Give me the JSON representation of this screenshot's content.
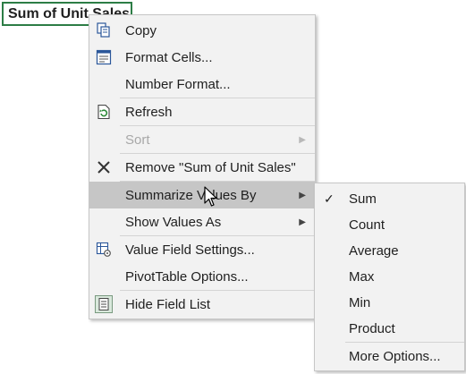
{
  "cell": {
    "text": "Sum of Unit Sales"
  },
  "context_menu": {
    "items": [
      {
        "label": "Copy",
        "icon": "copy-icon"
      },
      {
        "label": "Format Cells...",
        "icon": "format-cells-icon"
      },
      {
        "label": "Number Format..."
      },
      {
        "label": "Refresh",
        "icon": "refresh-icon"
      },
      {
        "label": "Sort",
        "disabled": true
      },
      {
        "label": "Remove \"Sum of Unit Sales\"",
        "icon": "remove-x-icon"
      },
      {
        "label": "Summarize Values By",
        "highlighted": true
      },
      {
        "label": "Show Values As"
      },
      {
        "label": "Value Field Settings...",
        "icon": "field-settings-icon"
      },
      {
        "label": "PivotTable Options..."
      },
      {
        "label": "Hide Field List",
        "icon": "field-list-icon"
      }
    ]
  },
  "submenu": {
    "items": [
      {
        "label": "Sum",
        "checked": true
      },
      {
        "label": "Count"
      },
      {
        "label": "Average"
      },
      {
        "label": "Max"
      },
      {
        "label": "Min"
      },
      {
        "label": "Product"
      },
      {
        "label": "More Options..."
      }
    ]
  }
}
